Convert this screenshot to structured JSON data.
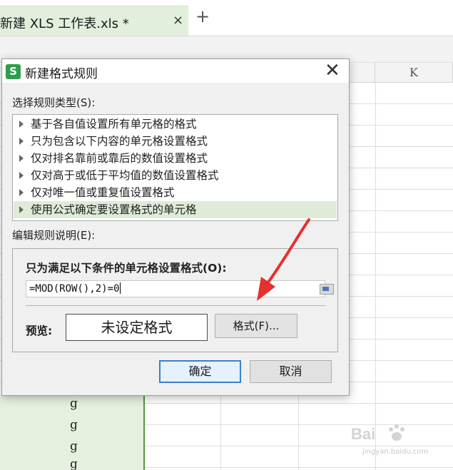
{
  "tab": {
    "title": "新建 XLS 工作表.xls *",
    "close_glyph": "×",
    "new_glyph": "+"
  },
  "grid": {
    "column_k": "K",
    "cell_value": "g"
  },
  "dialog": {
    "logo": "S",
    "title": "新建格式规则",
    "close_glyph": "✕",
    "rule_type_label": "选择规则类型(S):",
    "rules": [
      {
        "label": "基于各自值设置所有单元格的格式",
        "selected": false
      },
      {
        "label": "只为包含以下内容的单元格设置格式",
        "selected": false
      },
      {
        "label": "仅对排名靠前或靠后的数值设置格式",
        "selected": false
      },
      {
        "label": "仅对高于或低于平均值的数值设置格式",
        "selected": false
      },
      {
        "label": "仅对唯一值或重复值设置格式",
        "selected": false
      },
      {
        "label": "使用公式确定要设置格式的单元格",
        "selected": true
      }
    ],
    "description_label": "编辑规则说明(E):",
    "condition_label": "只为满足以下条件的单元格设置格式(O):",
    "formula_value": "=MOD(ROW(),2)=0",
    "preview_label": "预览:",
    "preview_text": "未设定格式",
    "format_button": "格式(F)...",
    "ok_button": "确定",
    "cancel_button": "取消"
  },
  "watermark": {
    "text": "jingyan.baidu.com"
  },
  "colors": {
    "accent_green": "#4d9a3d",
    "selection_green": "#dfebd8",
    "arrow_red": "#e53030",
    "ok_border": "#3c7fd0"
  }
}
